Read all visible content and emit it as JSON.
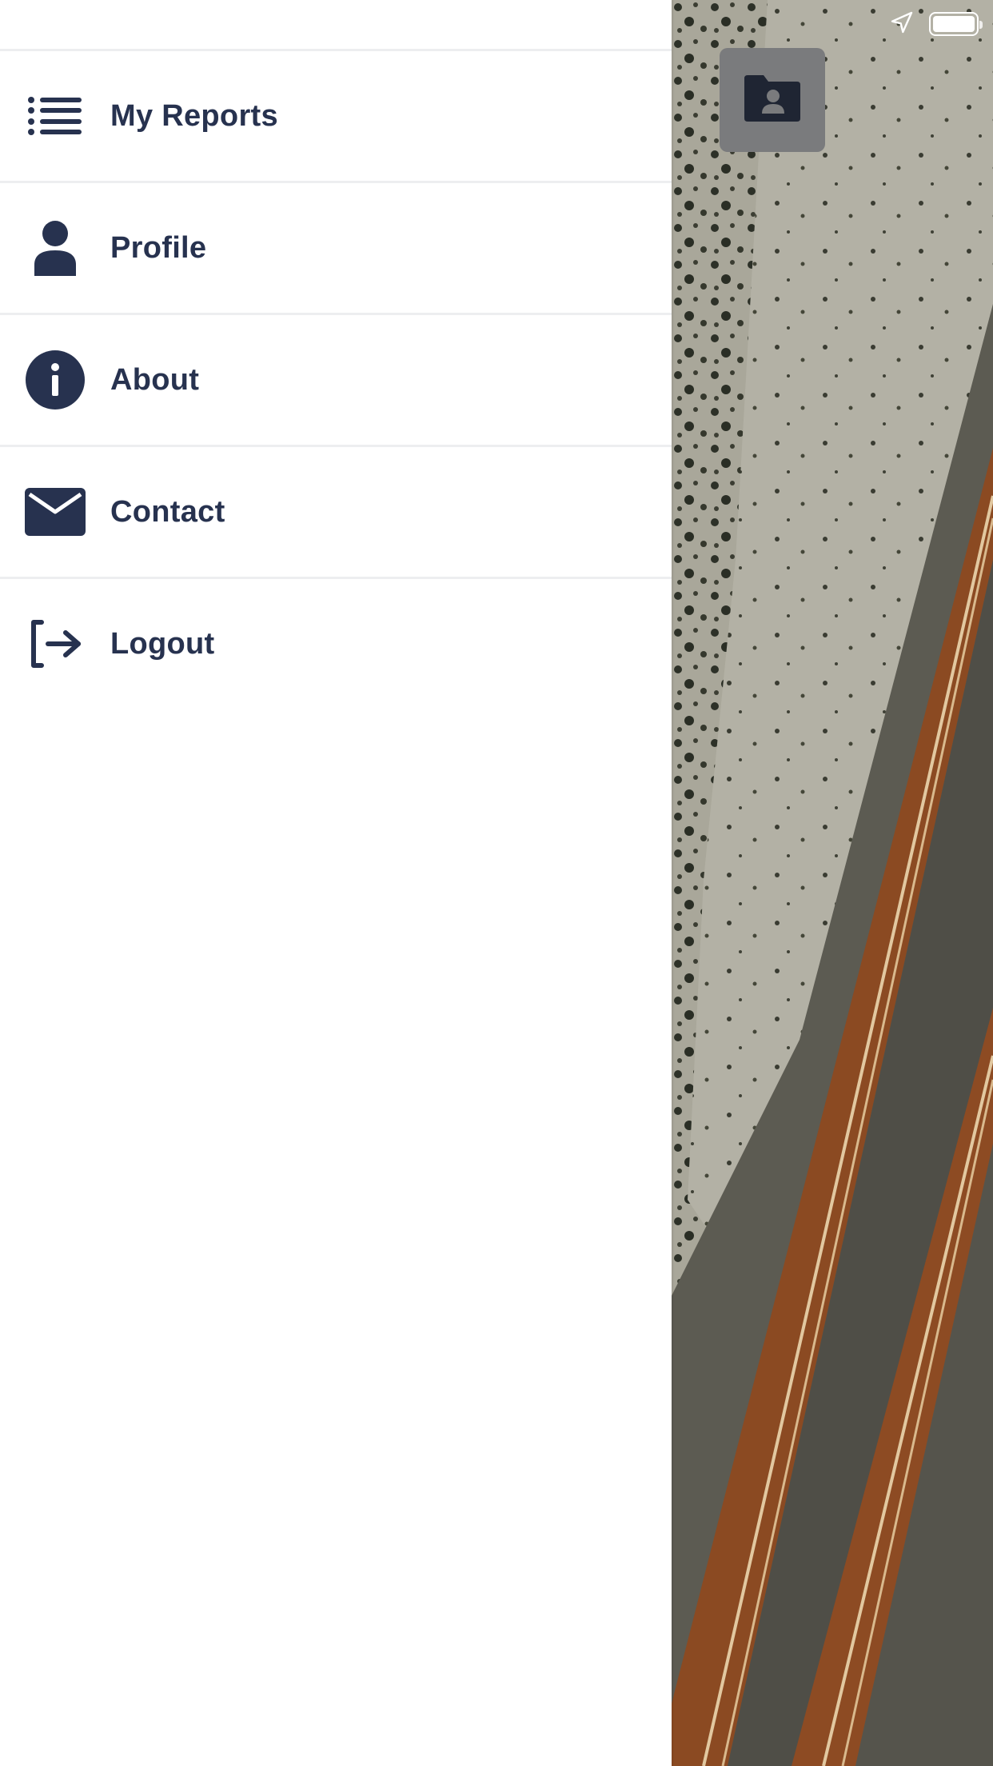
{
  "theme": {
    "drawer_background": "#ffffff",
    "text_color": "#27324f",
    "icon_color": "#27324f",
    "divider_color": "#edeef0",
    "folder_button_color": "#7a7b7d"
  },
  "status_bar": {
    "icons": [
      "location-arrow-icon",
      "battery-icon"
    ],
    "battery_level": 1.0
  },
  "map": {
    "folder_button_icon": "folder-user-icon"
  },
  "menu": {
    "items": [
      {
        "label": "My Reports",
        "icon": "list-icon"
      },
      {
        "label": "Profile",
        "icon": "user-icon"
      },
      {
        "label": "About",
        "icon": "info-icon"
      },
      {
        "label": "Contact",
        "icon": "envelope-icon"
      },
      {
        "label": "Logout",
        "icon": "logout-icon"
      }
    ]
  }
}
